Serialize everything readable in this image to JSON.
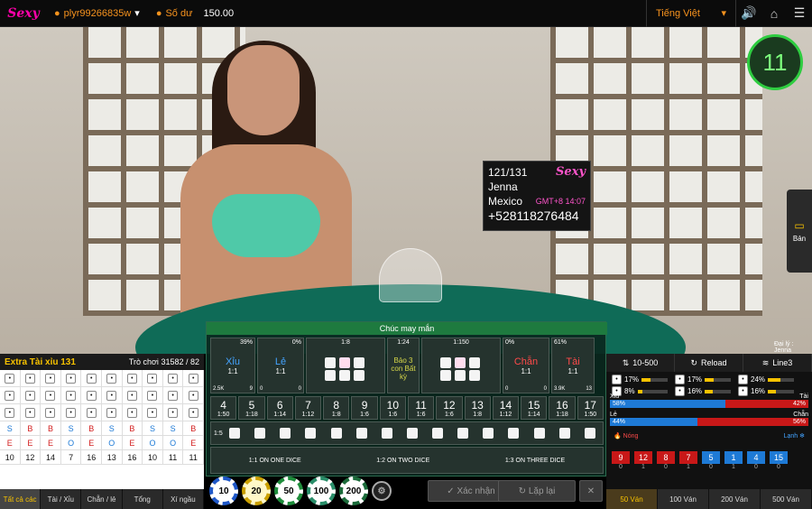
{
  "topbar": {
    "username": "plyr99266835w",
    "balance_label": "Số dư",
    "balance": "150.00",
    "language": "Tiếng Việt"
  },
  "video": {
    "timer": "11",
    "side_label": "Bản",
    "dealer_label": "Đại lý : Jenna"
  },
  "info_card": {
    "round": "121/131",
    "name": "Jenna",
    "country": "Mexico",
    "phone": "+528118276484",
    "gmt": "GMT+8 14:07"
  },
  "left": {
    "title": "Extra Tài xỉu 131",
    "game_label": "Trò chơi",
    "game_value": "31582 / 82",
    "row_sb": [
      "S",
      "B",
      "B",
      "S",
      "B",
      "S",
      "B",
      "S",
      "S",
      "B"
    ],
    "row_eo": [
      "E",
      "E",
      "E",
      "O",
      "E",
      "O",
      "E",
      "O",
      "O",
      "E"
    ],
    "sums": [
      "10",
      "12",
      "14",
      "7",
      "16",
      "13",
      "16",
      "10",
      "11",
      "11"
    ],
    "tabs": [
      "Tất cả các",
      "Tài / Xỉu",
      "Chẵn / lẻ",
      "Tổng",
      "Xí ngầu"
    ]
  },
  "board": {
    "banner": "Chúc may mắn",
    "big": {
      "xiu": "Xỉu",
      "xiu_pct": "39%",
      "xiu_odds": "1:1",
      "xiu_amt": "2.5K",
      "xiu_cnt": "9",
      "le": "Lẻ",
      "le_pct": "0%",
      "le_odds": "1:1",
      "le_amt": "0",
      "le_cnt": "0",
      "pair_odds": "1:8",
      "any3_odds": "1:24",
      "any3_text": "Bảo 3 con Bất kỳ",
      "triple_odds": "1:150",
      "chan": "Chẵn",
      "chan_pct": "0%",
      "chan_odds": "1:1",
      "chan_amt": "0",
      "chan_cnt": "0",
      "tai": "Tài",
      "tai_pct": "61%",
      "tai_odds": "1:1",
      "tai_amt": "3.9K",
      "tai_cnt": "13"
    },
    "nums": [
      [
        "4",
        "1:50"
      ],
      [
        "5",
        "1:18"
      ],
      [
        "6",
        "1:14"
      ],
      [
        "7",
        "1:12"
      ],
      [
        "8",
        "1:8"
      ],
      [
        "9",
        "1:6"
      ],
      [
        "10",
        "1:6"
      ],
      [
        "11",
        "1:6"
      ],
      [
        "12",
        "1:6"
      ],
      [
        "13",
        "1:8"
      ],
      [
        "14",
        "1:12"
      ],
      [
        "15",
        "1:14"
      ],
      [
        "16",
        "1:18"
      ],
      [
        "17",
        "1:50"
      ]
    ],
    "combo_odds": "1:5",
    "single": [
      "1:1 ON ONE DICE",
      "1:2 ON TWO DICE",
      "1:3 ON THREE DICE"
    ]
  },
  "chips": [
    "10",
    "20",
    "50",
    "100",
    "200"
  ],
  "buttons": {
    "confirm": "Xác nhận",
    "repeat": "Lặp lại"
  },
  "right": {
    "tabs_top": [
      "10-500",
      "Reload",
      "Line3"
    ],
    "stats": [
      "17%",
      "17%",
      "24%",
      "8%",
      "16%",
      "16%"
    ],
    "xiu": "Xỉu",
    "tai": "Tài",
    "xiu_pct": "58%",
    "tai_pct": "42%",
    "le": "Lẻ",
    "chan": "Chẵn",
    "le_pct": "44%",
    "chan_pct": "56%",
    "hot": "Nóng",
    "cold": "Lạnh",
    "hist": [
      "9",
      "12",
      "8",
      "7",
      "5",
      "1",
      "4",
      "15"
    ],
    "hist_counts": [
      "0",
      "1",
      "0",
      "1",
      "0",
      "1",
      "0",
      "0"
    ],
    "tabs": [
      "50 Ván",
      "100 Ván",
      "200 Ván",
      "500 Ván"
    ]
  }
}
